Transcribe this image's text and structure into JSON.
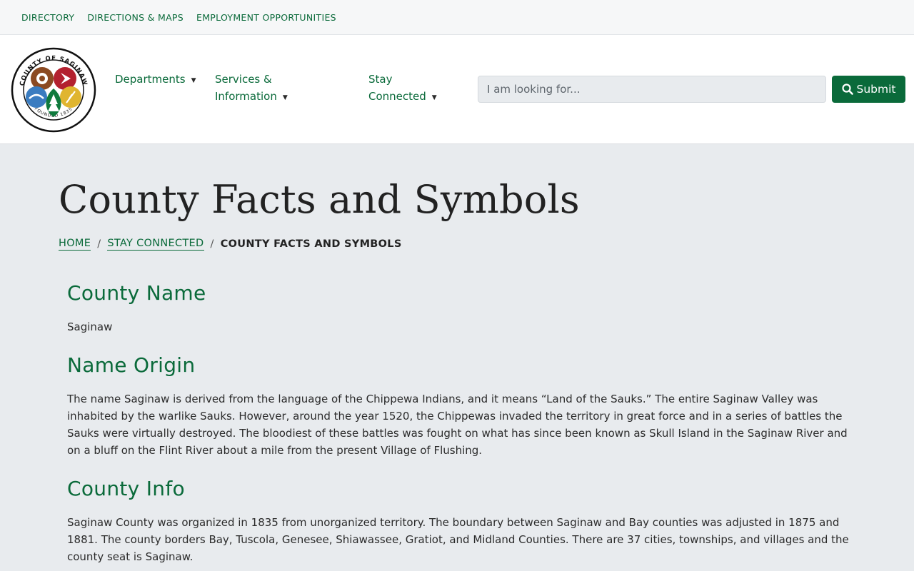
{
  "utility_nav": [
    "Directory",
    "Directions & Maps",
    "Employment Opportunities"
  ],
  "logo": {
    "ring_top_text": "COUNTY OF SAGINAW",
    "ring_bottom_text": "FOUNDED 1835"
  },
  "main_nav": {
    "departments": "Departments",
    "services_line1": "Services &",
    "services_line2": "Information",
    "stay_line1": "Stay",
    "stay_line2": "Connected"
  },
  "search": {
    "placeholder": "I am looking for...",
    "submit_label": "Submit"
  },
  "page": {
    "title": "County Facts and Symbols"
  },
  "breadcrumb": {
    "home": "Home",
    "stay_connected": "Stay Connected",
    "current": "County Facts and Symbols",
    "separator": "/"
  },
  "sections": {
    "county_name_heading": "County Name",
    "county_name_text": "Saginaw",
    "name_origin_heading": "Name Origin",
    "name_origin_text": "The name Saginaw is derived from the language of the Chippewa Indians, and it means “Land of the Sauks.” The entire Saginaw Valley was inhabited by the warlike Sauks. However, around the year 1520, the Chippewas invaded the territory in great force and in a series of battles the Sauks were virtually destroyed. The bloodiest of these battles was fought on what has since been known as Skull Island in the Saginaw River and on a bluff on the Flint River about a mile from the present Village of Flushing.",
    "county_info_heading": "County Info",
    "county_info_text": "Saginaw County was organized in 1835 from unorganized territory.  The boundary between Saginaw and Bay counties was adjusted in 1875 and 1881.  The county borders Bay, Tuscola, Genesee, Shiawassee, Gratiot, and Midland Counties.  There are 37 cities, townships, and villages and the county seat is Saginaw."
  },
  "colors": {
    "brand_green": "#0a6a3a",
    "page_background": "#e8ebee",
    "logo_brown": "#8b4a22",
    "logo_red": "#b3212f",
    "logo_blue": "#3a7cc0",
    "logo_gold": "#e0b530",
    "logo_green": "#0f7a3d"
  }
}
